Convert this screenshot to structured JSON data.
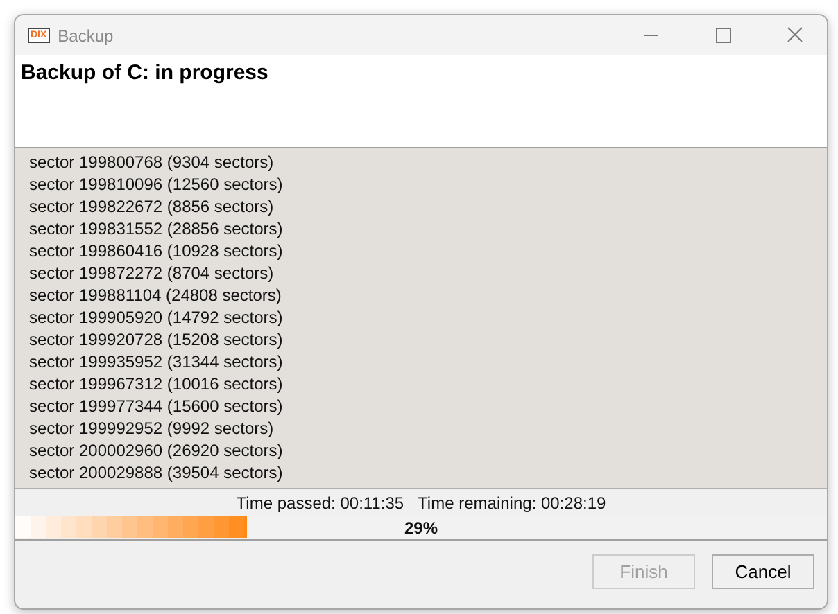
{
  "window": {
    "title": "Backup",
    "app_icon_text": "DIX"
  },
  "header": {
    "title": "Backup of C: in progress"
  },
  "log": [
    "sector 199800768 (9304 sectors)",
    "sector 199810096 (12560 sectors)",
    "sector 199822672 (8856 sectors)",
    "sector 199831552 (28856 sectors)",
    "sector 199860416 (10928 sectors)",
    "sector 199872272 (8704 sectors)",
    "sector 199881104 (24808 sectors)",
    "sector 199905920 (14792 sectors)",
    "sector 199920728 (15208 sectors)",
    "sector 199935952 (31344 sectors)",
    "sector 199967312 (10016 sectors)",
    "sector 199977344 (15600 sectors)",
    "sector 199992952 (9992 sectors)",
    "sector 200002960 (26920 sectors)",
    "sector 200029888 (39504 sectors)"
  ],
  "status": {
    "time_passed": "Time passed: 00:11:35",
    "time_remaining": "Time remaining: 00:28:19"
  },
  "progress": {
    "label": "29%"
  },
  "buttons": [
    {
      "label": "Finish",
      "disabled": true
    },
    {
      "label": "Cancel",
      "disabled": false
    }
  ]
}
